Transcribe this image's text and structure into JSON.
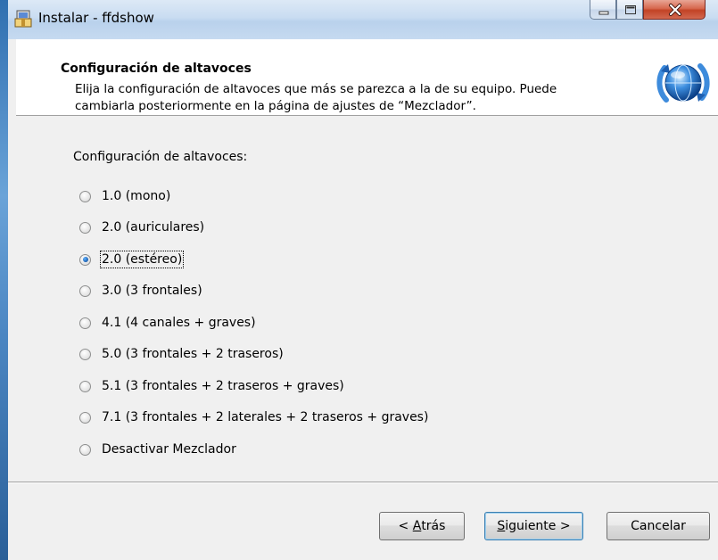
{
  "window": {
    "title": "Instalar - ffdshow",
    "app_icon": "installer-icon",
    "controls": [
      "minimize-icon",
      "maximize-icon",
      "close-icon"
    ]
  },
  "header": {
    "title": "Configuración de altavoces",
    "subtitle": "Elija la configuración de altavoces que más se parezca a la de su equipo. Puede cambiarla posteriormente en la página de ajustes de “Mezclador”.",
    "icon": "ffdshow-globe-icon"
  },
  "group_label": "Configuración de altavoces:",
  "options": [
    {
      "label": "1.0 (mono)",
      "checked": false
    },
    {
      "label": "2.0 (auriculares)",
      "checked": false
    },
    {
      "label": "2.0 (estéreo)",
      "checked": true
    },
    {
      "label": "3.0 (3 frontales)",
      "checked": false
    },
    {
      "label": "4.1 (4 canales + graves)",
      "checked": false
    },
    {
      "label": "5.0 (3 frontales + 2 traseros)",
      "checked": false
    },
    {
      "label": "5.1 (3 frontales + 2 traseros + graves)",
      "checked": false
    },
    {
      "label": "7.1 (3 frontales + 2 laterales + 2 traseros + graves)",
      "checked": false
    },
    {
      "label": "Desactivar Mezclador",
      "checked": false
    }
  ],
  "buttons": {
    "back": {
      "pre": "< ",
      "accel": "A",
      "rest": "trás"
    },
    "next": {
      "accel": "S",
      "rest": "iguiente >"
    },
    "cancel": "Cancelar"
  },
  "colors": {
    "titlebar": "#c9dcf1",
    "close_button": "#c24326",
    "dialog_bg": "#f0f0f0",
    "radio_selected": "#1b5eaf"
  }
}
